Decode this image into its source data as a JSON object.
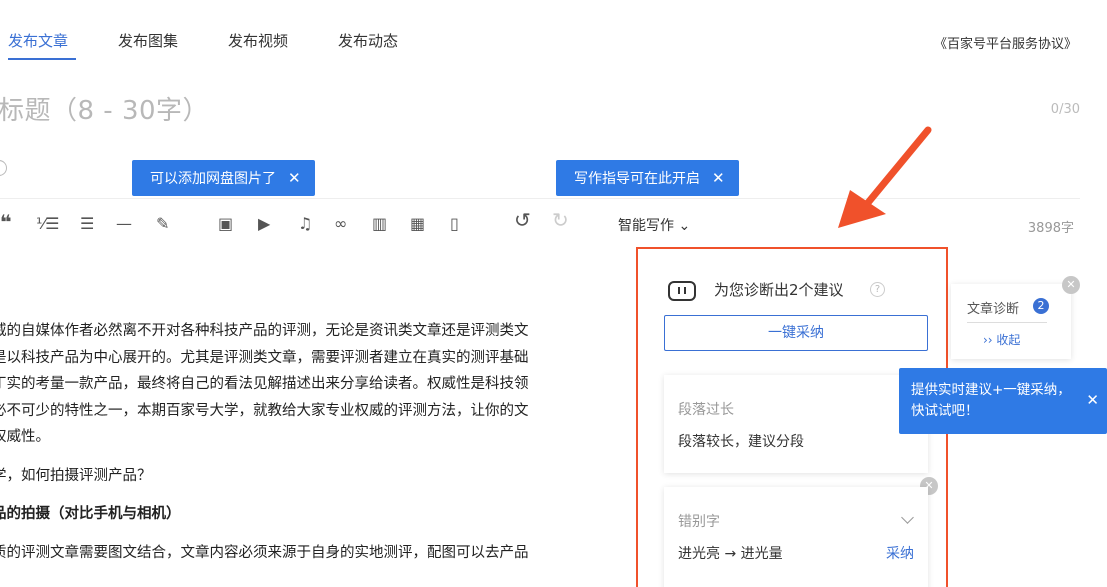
{
  "tabs": [
    {
      "label": "发布文章",
      "active": true
    },
    {
      "label": "发布图集",
      "active": false
    },
    {
      "label": "发布视频",
      "active": false
    },
    {
      "label": "发布动态",
      "active": false
    }
  ],
  "agreement": "《百家号平台服务协议》",
  "title_placeholder": "标题（8 - 30字）",
  "title_count": "0/30",
  "tip_netdisk": "可以添加网盘图片了",
  "tip_guide": "写作指导可在此开启",
  "toolbar": {
    "quote_icon": "quote-icon",
    "smart_write": "智能写作",
    "word_count": "3898字"
  },
  "article": {
    "lines": [
      "威的自媒体作者必然离不开对各种科技产品的评测，无论是资讯类文章还是评测类文",
      "是以科技产品为中心展开的。尤其是评测类文章，需要评测者建立在真实的测评基础",
      "丁实的考量一款产品，最终将自己的看法见解描述出来分享给读者。权威性是科技领",
      "必不可少的特性之一，本期百家号大学，就教给大家专业权威的评测方法，让你的文",
      "权威性。"
    ],
    "q1": "学，如何拍摄评测产品？",
    "h1": "品的拍摄（对比手机与相机）",
    "p2": "质的评测文章需要图文结合，文章内容必须来源于自身的实地测评，配图可以去产品"
  },
  "panel": {
    "heading": "为您诊断出2个建议",
    "adopt_all": "一键采纳",
    "cards": [
      {
        "type": "段落过长",
        "text": "段落较长，建议分段"
      },
      {
        "type": "错别字",
        "text": "进光亮 → 进光量",
        "action": "采纳"
      }
    ]
  },
  "diagnosis": {
    "title": "文章诊断",
    "badge": "2",
    "collapse": "›› 收起"
  },
  "tip_realtime": {
    "line1": "提供实时建议+一键采纳，",
    "line2": "快试试吧！"
  },
  "colors": {
    "accent": "#3a70d4",
    "tip_bg": "#2f7ae5",
    "highlight": "#f0512b"
  }
}
